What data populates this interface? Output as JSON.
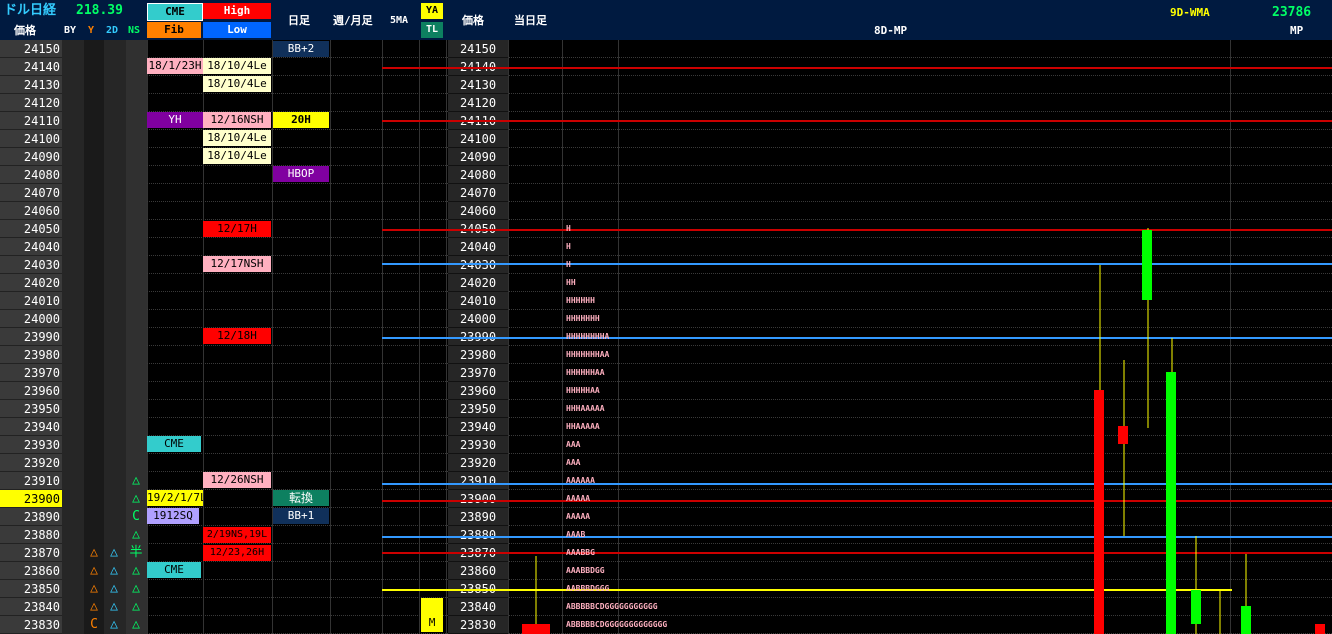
{
  "header": {
    "title": "ドル日経",
    "value": "218.39",
    "cme": "CME",
    "high": "High",
    "fib": "Fib",
    "low": "Low",
    "daily": "日足",
    "weekly_monthly": "週/月足",
    "ma5": "5MA",
    "ya": "YA",
    "tl": "TL",
    "price": "価格",
    "today": "当日足",
    "mp_label": "8D-MP",
    "wma_label": "9D-WMA",
    "wma_value": "23786",
    "mp": "MP",
    "col_price": "価格",
    "col_by": "BY",
    "col_y": "Y",
    "col_2d": "2D",
    "col_ns": "NS"
  },
  "prices": [
    "24150",
    "24140",
    "24130",
    "24120",
    "24110",
    "24100",
    "24090",
    "24080",
    "24070",
    "24060",
    "24050",
    "24040",
    "24030",
    "24020",
    "24010",
    "24000",
    "23990",
    "23980",
    "23970",
    "23960",
    "23950",
    "23940",
    "23930",
    "23920",
    "23910",
    "23900",
    "23890",
    "23880",
    "23870",
    "23860",
    "23850",
    "23840",
    "23830"
  ],
  "highlight_price": "23900",
  "tags": {
    "cme_18": "18/1/23H",
    "hi_a": "18/10/4Le",
    "hi_b": "18/10/4Le",
    "yh": "YH",
    "hi_12_16": "12/16NSH",
    "hi_c": "18/10/4Le",
    "hi_d": "18/10/4Le",
    "bb2": "BB+2",
    "h20": "20H",
    "hbop": "HBOP",
    "h1217": "12/17H",
    "h1217ns": "12/17NSH",
    "h1218": "12/18H",
    "cme_1": "CME",
    "h1226": "12/26NSH",
    "c1921": "19/2/1/7L",
    "tenkan": "転換",
    "s1912": "1912SQ",
    "bb1": "BB+1",
    "l1219": "2/19NS,19L",
    "l1223": "12/23,26H",
    "cme_2": "CME",
    "m": "M"
  },
  "marks": {
    "tri": "△",
    "c": "C",
    "han": "半"
  },
  "mp_rows": [
    {
      "row": 10,
      "text": "H"
    },
    {
      "row": 11,
      "text": "H"
    },
    {
      "row": 12,
      "text": "H"
    },
    {
      "row": 13,
      "text": "HH"
    },
    {
      "row": 14,
      "text": "HHHHHH"
    },
    {
      "row": 15,
      "text": "HHHHHHH"
    },
    {
      "row": 16,
      "text": "HHHHHHHHA"
    },
    {
      "row": 17,
      "text": "HHHHHHHAA"
    },
    {
      "row": 18,
      "text": "HHHHHHAA"
    },
    {
      "row": 19,
      "text": "HHHHHAA"
    },
    {
      "row": 20,
      "text": "HHHAAAAA"
    },
    {
      "row": 21,
      "text": "HHAAAAA"
    },
    {
      "row": 22,
      "text": "AAA"
    },
    {
      "row": 23,
      "text": "AAA"
    },
    {
      "row": 24,
      "text": "AAAAAA"
    },
    {
      "row": 25,
      "text": "AAAAA"
    },
    {
      "row": 26,
      "text": "AAAAA"
    },
    {
      "row": 27,
      "text": "AAAB"
    },
    {
      "row": 28,
      "text": "AAABBG"
    },
    {
      "row": 29,
      "text": "AAABBDGG"
    },
    {
      "row": 30,
      "text": "AABBBDGGG"
    },
    {
      "row": 31,
      "text": "ABBBBBCDGGGGGGGGGGG"
    },
    {
      "row": 32,
      "text": "ABBBBBCDGGGGGGGGGGGGG"
    }
  ],
  "colors": {
    "header_bg": "#001a40",
    "cme": "#33cccc",
    "high": "#ff0000",
    "fib": "#ff8000",
    "low": "#0066ff",
    "pink": "#ffb0c0",
    "cream": "#ffffcc",
    "purple": "#8000a0",
    "yellow": "#ffff00",
    "green_bg": "#0d8060",
    "navy": "#10305a"
  }
}
